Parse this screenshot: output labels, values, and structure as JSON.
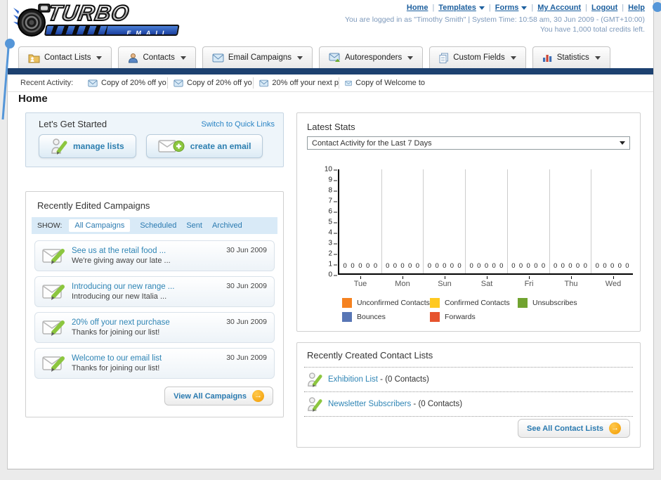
{
  "logo": {
    "word": "TURBO",
    "sub": "EMAIL"
  },
  "header": {
    "links": [
      {
        "label": "Home",
        "dropdown": false
      },
      {
        "label": "Templates",
        "dropdown": true
      },
      {
        "label": "Forms",
        "dropdown": true
      },
      {
        "label": "My Account",
        "dropdown": false
      },
      {
        "label": "Logout",
        "dropdown": false
      },
      {
        "label": "Help",
        "dropdown": false
      }
    ],
    "login_info": "You are logged in as \"Timothy Smith\" | System Time: 10:58 am, 30 Jun 2009 - (GMT+10:00)",
    "credits_info": "You have 1,000 total credits left."
  },
  "nav": {
    "tabs": [
      {
        "label": "Contact Lists"
      },
      {
        "label": "Contacts"
      },
      {
        "label": "Email Campaigns"
      },
      {
        "label": "Autoresponders"
      },
      {
        "label": "Custom Fields"
      },
      {
        "label": "Statistics"
      }
    ]
  },
  "recent_activity": {
    "label": "Recent Activity:",
    "items": [
      {
        "label": "Copy of 20% off yo"
      },
      {
        "label": "Copy of 20% off yo"
      },
      {
        "label": "20% off your next p"
      },
      {
        "label": "Copy of Welcome to"
      }
    ]
  },
  "page": {
    "title": "Home"
  },
  "get_started": {
    "title": "Let's Get Started",
    "switch_link": "Switch to Quick Links",
    "manage_lists_label": "manage lists",
    "create_email_label": "create an email"
  },
  "campaigns": {
    "title": "Recently Edited Campaigns",
    "show_label": "SHOW:",
    "filters": [
      {
        "label": "All Campaigns",
        "selected": true
      },
      {
        "label": "Scheduled",
        "selected": false
      },
      {
        "label": "Sent",
        "selected": false
      },
      {
        "label": "Archived",
        "selected": false
      }
    ],
    "items": [
      {
        "title": "See us at the retail food ...",
        "subtitle": "We're giving away our late ...",
        "date": "30 Jun 2009"
      },
      {
        "title": "Introducing our new range ...",
        "subtitle": "Introducing our new Italia ...",
        "date": "30 Jun 2009"
      },
      {
        "title": "20% off your next purchase",
        "subtitle": "Thanks for joining our list!",
        "date": "30 Jun 2009"
      },
      {
        "title": "Welcome to our email list",
        "subtitle": "Thanks for joining our list!",
        "date": "30 Jun 2009"
      }
    ],
    "view_all_label": "View All Campaigns"
  },
  "stats": {
    "title": "Latest Stats",
    "selector_value": "Contact Activity for the Last 7 Days"
  },
  "chart_data": {
    "type": "bar",
    "title": "Contact Activity for the Last 7 Days",
    "categories": [
      "Tue",
      "Mon",
      "Sun",
      "Sat",
      "Fri",
      "Thu",
      "Wed"
    ],
    "series": [
      {
        "name": "Unconfirmed Contacts",
        "color": "#f58220",
        "values": [
          0,
          0,
          0,
          0,
          0,
          0,
          0
        ]
      },
      {
        "name": "Confirmed Contacts",
        "color": "#ffc920",
        "values": [
          0,
          0,
          0,
          0,
          0,
          0,
          0
        ]
      },
      {
        "name": "Unsubscribes",
        "color": "#71a330",
        "values": [
          0,
          0,
          0,
          0,
          0,
          0,
          0
        ]
      },
      {
        "name": "Bounces",
        "color": "#5876b5",
        "values": [
          0,
          0,
          0,
          0,
          0,
          0,
          0
        ]
      },
      {
        "name": "Forwards",
        "color": "#e6532d",
        "values": [
          0,
          0,
          0,
          0,
          0,
          0,
          0
        ]
      }
    ],
    "ylim": [
      0,
      10
    ],
    "yticks": [
      10,
      9,
      8,
      7,
      6,
      5,
      4,
      3,
      2,
      1,
      0
    ],
    "grid": "vertical",
    "legend_position": "bottom",
    "value_labels_shown": true
  },
  "contact_lists": {
    "title": "Recently Created Contact Lists",
    "items": [
      {
        "name": "Exhibition List",
        "suffix": " - (0 Contacts)"
      },
      {
        "name": "Newsletter Subscribers",
        "suffix": " - (0 Contacts)"
      }
    ],
    "see_all_label": "See All Contact Lists"
  },
  "colors": {
    "navy_bar": "#1d4170",
    "link_blue": "#2a7ab0",
    "header_link": "#1c5f9e",
    "panel_tint": "#eef5fa",
    "show_bar": "#d9eaf7",
    "orange_button": "#f29b00",
    "callout_blue": "#5596d8"
  }
}
